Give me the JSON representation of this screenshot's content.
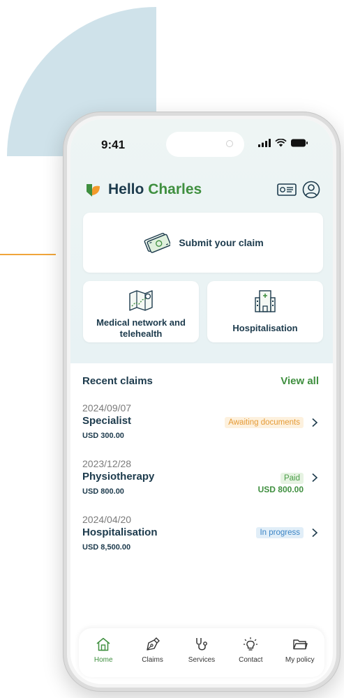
{
  "status_bar": {
    "time": "9:41"
  },
  "header": {
    "greeting": "Hello",
    "name": "Charles"
  },
  "actions": {
    "submit": "Submit your claim",
    "network": "Medical network and telehealth",
    "hospitalisation": "Hospitalisation"
  },
  "recent": {
    "title": "Recent claims",
    "view_all": "View all"
  },
  "claims": [
    {
      "date": "2024/09/07",
      "title": "Specialist",
      "amount": "USD 300.00",
      "status": "Awaiting documents"
    },
    {
      "date": "2023/12/28",
      "title": "Physiotherapy",
      "amount": "USD 800.00",
      "status": "Paid",
      "paid_amount": "USD 800.00"
    },
    {
      "date": "2024/04/20",
      "title": "Hospitalisation",
      "amount": "USD 8,500.00",
      "status": "In progress"
    }
  ],
  "nav": [
    {
      "label": "Home",
      "icon": "home-icon",
      "active": true
    },
    {
      "label": "Claims",
      "icon": "pen-icon"
    },
    {
      "label": "Services",
      "icon": "stethoscope-icon"
    },
    {
      "label": "Contact",
      "icon": "lightbulb-icon"
    },
    {
      "label": "My policy",
      "icon": "folder-icon"
    }
  ],
  "colors": {
    "green": "#3f8f3f",
    "navy": "#1c3a4c",
    "orange": "#e59a35",
    "blue": "#3b84c5"
  }
}
